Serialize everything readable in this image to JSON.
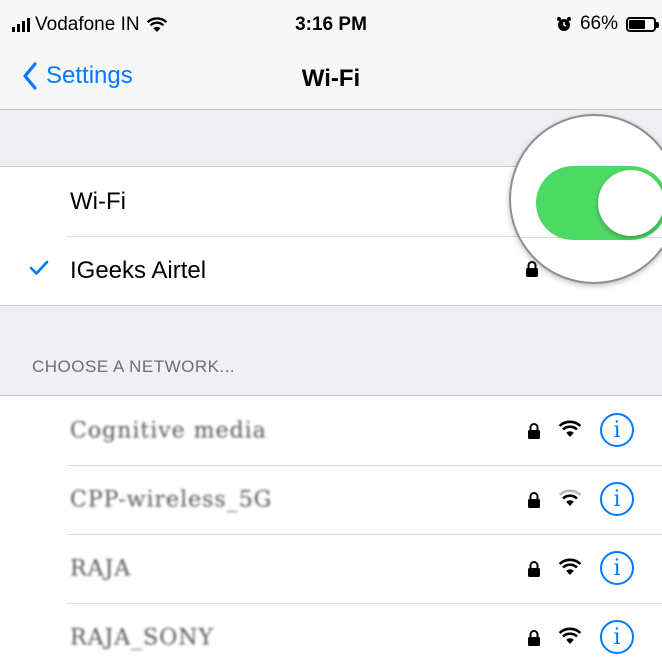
{
  "status_bar": {
    "carrier": "Vodafone IN",
    "time": "3:16 PM",
    "battery_percent": "66%",
    "battery_level": 0.66,
    "icons": [
      "signal-bars-icon",
      "wifi-icon",
      "alarm-icon",
      "battery-icon"
    ]
  },
  "nav": {
    "back_label": "Settings",
    "title": "Wi-Fi"
  },
  "wifi_group": {
    "toggle_label": "Wi-Fi",
    "toggle_on": true,
    "connected_network": "IGeeks Airtel"
  },
  "section_header": "CHOOSE A NETWORK...",
  "networks": [
    {
      "name": "Cognitive media",
      "locked": true,
      "info": "i"
    },
    {
      "name": "CPP-wireless_5G",
      "locked": true,
      "info": "i"
    },
    {
      "name": "RAJA",
      "locked": true,
      "info": "i"
    },
    {
      "name": "RAJA_SONY",
      "locked": true,
      "info": "i"
    }
  ],
  "colors": {
    "accent": "#007aff",
    "toggle_on": "#4cd964",
    "background": "#efeff4"
  }
}
